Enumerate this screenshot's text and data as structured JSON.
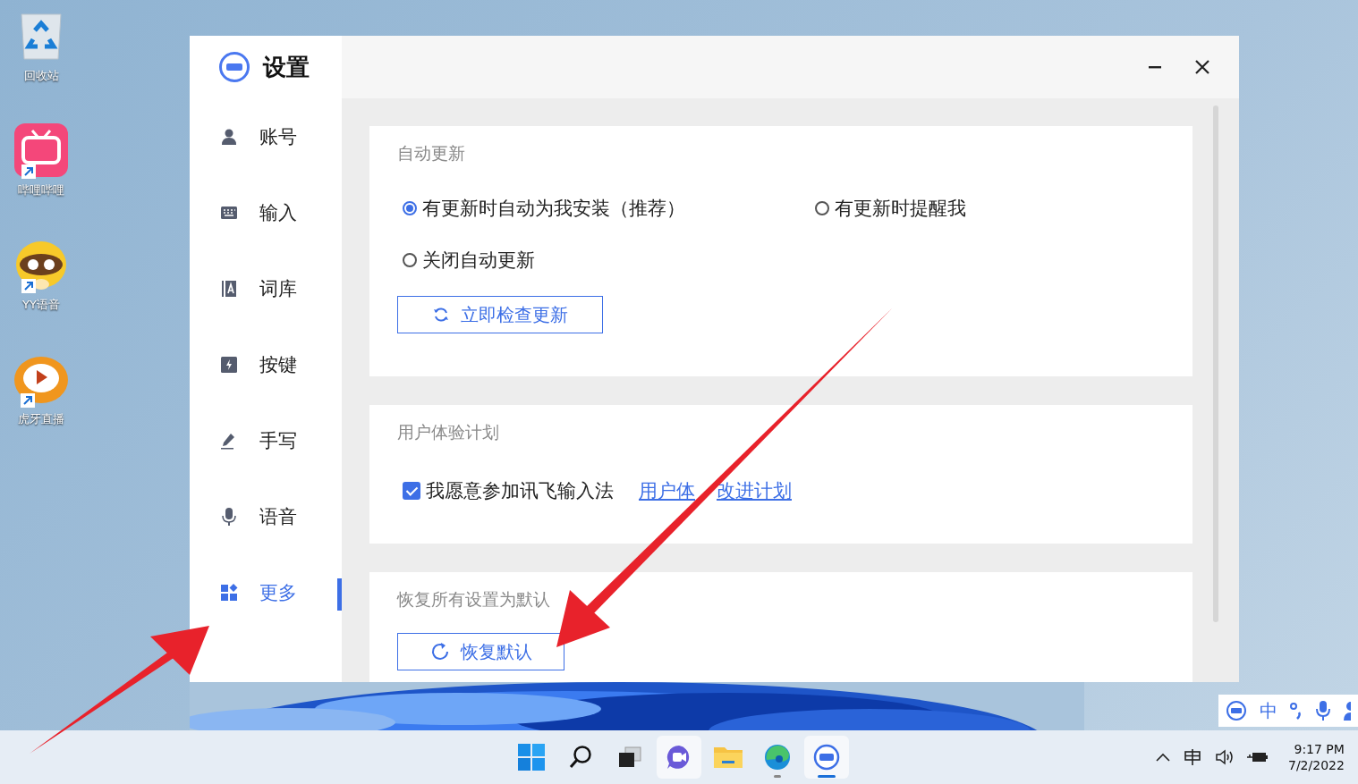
{
  "desktop_icons": [
    {
      "kind": "recycle",
      "label": "回收站"
    },
    {
      "kind": "pink-tv",
      "label": "哔哩哔哩"
    },
    {
      "kind": "raccoon",
      "label": "YY语音"
    },
    {
      "kind": "tiger",
      "label": "虎牙直播"
    }
  ],
  "window": {
    "title": "设置"
  },
  "sidebar": {
    "items": [
      {
        "kind": "person",
        "label": "账号",
        "selected": false
      },
      {
        "kind": "keyboard",
        "label": "输入",
        "selected": false
      },
      {
        "kind": "dictionary",
        "label": "词库",
        "selected": false
      },
      {
        "kind": "bolt",
        "label": "按键",
        "selected": false
      },
      {
        "kind": "pen",
        "label": "手写",
        "selected": false
      },
      {
        "kind": "mic",
        "label": "语音",
        "selected": false
      },
      {
        "kind": "grid",
        "label": "更多",
        "selected": true
      }
    ]
  },
  "sections": [
    {
      "kind": "radios",
      "title": "自动更新",
      "options": [
        {
          "label": "有更新时自动为我安装（推荐）",
          "selected": true
        },
        {
          "label": "有更新时提醒我",
          "selected": false
        },
        {
          "label": "关闭自动更新",
          "selected": false
        }
      ],
      "button": "立即检查更新"
    },
    {
      "kind": "checkbox",
      "title": "用户体验计划",
      "checkbox": {
        "label": "我愿意参加讯飞输入法",
        "checked": true
      },
      "link_parts": [
        "用户体",
        "改进计划"
      ]
    },
    {
      "kind": "restore",
      "title": "恢复所有设置为默认",
      "button": "恢复默认"
    }
  ],
  "ime_toolbar": {
    "mode": "中"
  },
  "taskbar": {
    "apps": [
      {
        "kind": "start",
        "running": false,
        "active": false,
        "highlighted": false
      },
      {
        "kind": "search",
        "running": false,
        "active": false,
        "highlighted": false
      },
      {
        "kind": "taskview",
        "running": false,
        "active": false,
        "highlighted": false
      },
      {
        "kind": "chat",
        "running": false,
        "active": false,
        "highlighted": true
      },
      {
        "kind": "folder",
        "running": false,
        "active": false,
        "highlighted": false
      },
      {
        "kind": "browser",
        "running": true,
        "active": false,
        "highlighted": false
      },
      {
        "kind": "ifly",
        "running": true,
        "active": true,
        "highlighted": true
      }
    ],
    "time": "9:17 PM",
    "date": "7/2/2022"
  }
}
